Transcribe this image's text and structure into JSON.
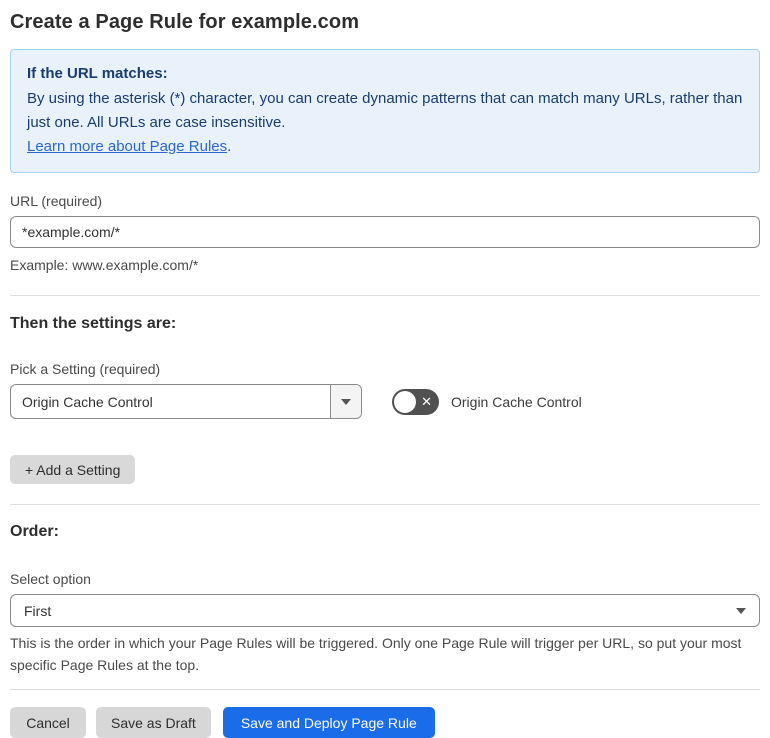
{
  "page": {
    "title": "Create a Page Rule for example.com"
  },
  "info_box": {
    "heading": "If the URL matches:",
    "body": "By using the asterisk (*) character, you can create dynamic patterns that can match many URLs, rather than just one. All URLs are case insensitive.",
    "link_label": "Learn more about Page Rules",
    "link_suffix": "."
  },
  "url_field": {
    "label": "URL (required)",
    "value": "*example.com/*",
    "helper": "Example: www.example.com/*"
  },
  "settings_section": {
    "heading": "Then the settings are:",
    "picker_label": "Pick a Setting (required)",
    "picker_value": "Origin Cache Control",
    "toggle_label": "Origin Cache Control",
    "toggle_state": "off",
    "add_button_label": "+ Add a Setting"
  },
  "order_section": {
    "heading": "Order:",
    "select_label": "Select option",
    "select_value": "First",
    "helper": "This is the order in which your Page Rules will be triggered. Only one Page Rule will trigger per URL, so put your most specific Page Rules at the top."
  },
  "footer": {
    "cancel_label": "Cancel",
    "save_draft_label": "Save as Draft",
    "save_deploy_label": "Save and Deploy Page Rule"
  },
  "icons": {
    "toggle_off_x": "✕"
  },
  "colors": {
    "accent_blue": "#1a6ce8",
    "info_bg": "#e9f2fb",
    "info_border": "#a9d2f0",
    "info_text": "#1b3c6e",
    "link_blue": "#2c67cf",
    "toggle_off_bg": "#515151"
  }
}
